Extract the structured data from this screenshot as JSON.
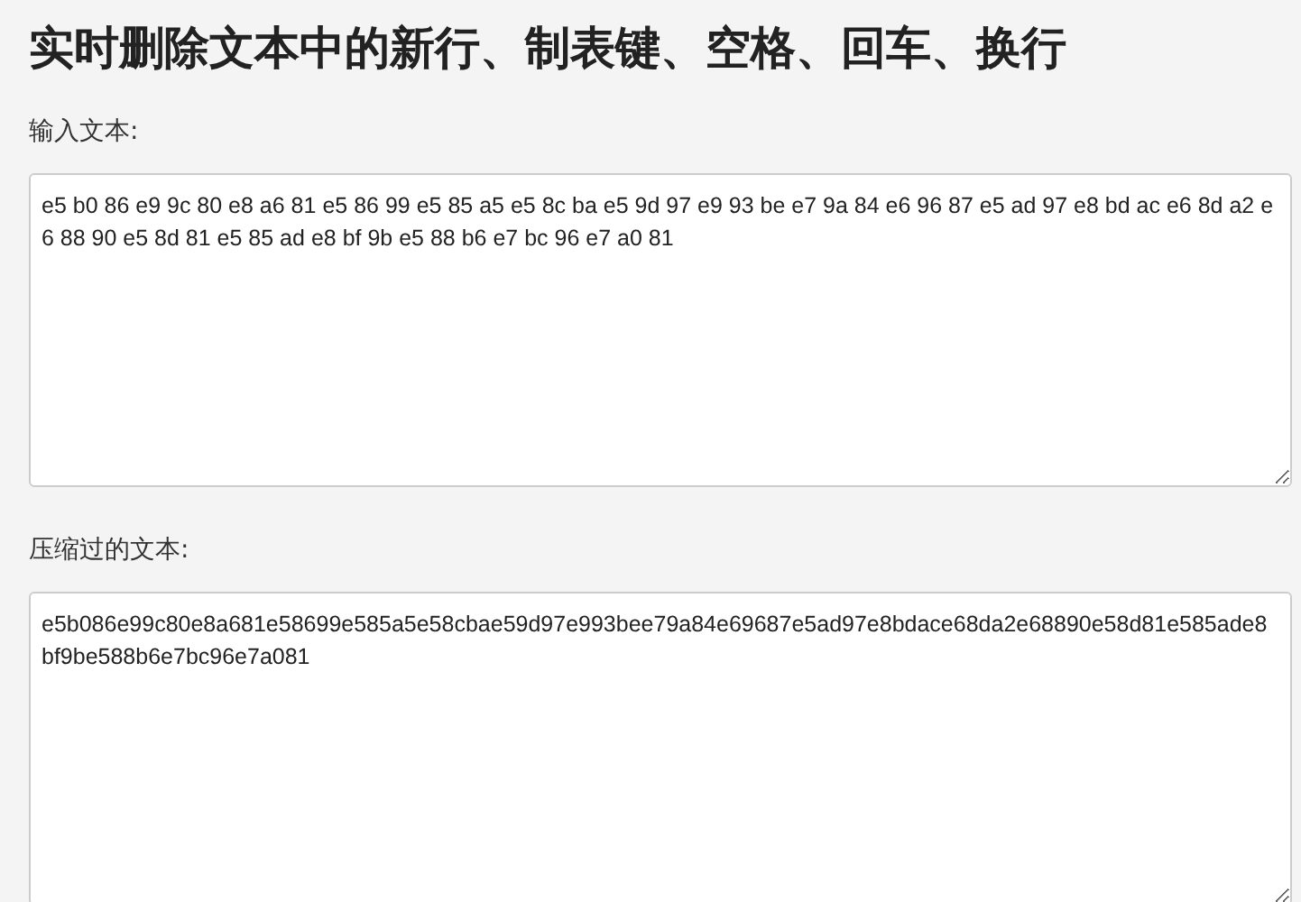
{
  "title": "实时删除文本中的新行、制表键、空格、回车、换行",
  "fields": [
    {
      "label": "输入文本:",
      "value": "e5 b0 86 e9 9c 80 e8 a6 81 e5 86 99 e5 85 a5 e5 8c ba e5 9d 97 e9 93 be e7 9a 84 e6 96 87 e5 ad 97 e8 bd ac e6 8d a2 e6 88 90 e5 8d 81 e5 85 ad e8 bf 9b e5 88 b6 e7 bc 96 e7 a0 81"
    },
    {
      "label": "压缩过的文本:",
      "value": "e5b086e99c80e8a681e58699e585a5e58cbae59d97e993bee79a84e69687e5ad97e8bdace68da2e68890e58d81e585ade8bf9be588b6e7bc96e7a081"
    }
  ]
}
